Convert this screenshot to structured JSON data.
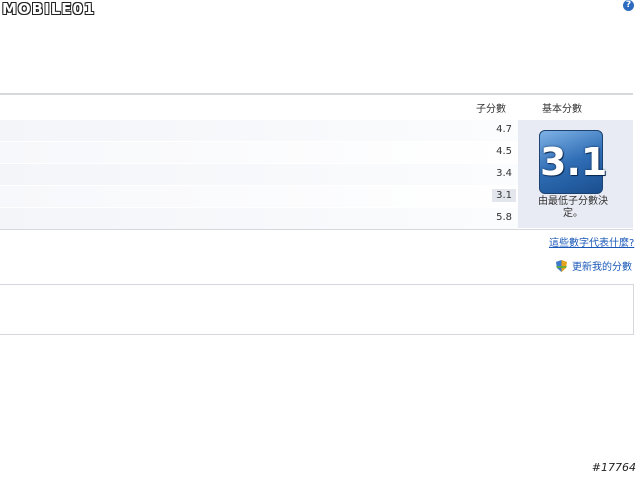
{
  "watermark": "MOBILE01",
  "columns": {
    "subscore": "子分數",
    "base": "基本分數"
  },
  "rows": [
    {
      "score": "4.7"
    },
    {
      "score": "4.5"
    },
    {
      "score": "3.4"
    },
    {
      "score": "3.1"
    },
    {
      "score": "5.8"
    }
  ],
  "base_score": {
    "value": "3.1",
    "caption": "由最低子分數決定。"
  },
  "links": {
    "what_mean": "這些數字代表什麼?",
    "refresh": "更新我的分數"
  },
  "image_id": "#17764",
  "colors": {
    "accent": "#1a58b8",
    "tile": "#2f6db5"
  }
}
